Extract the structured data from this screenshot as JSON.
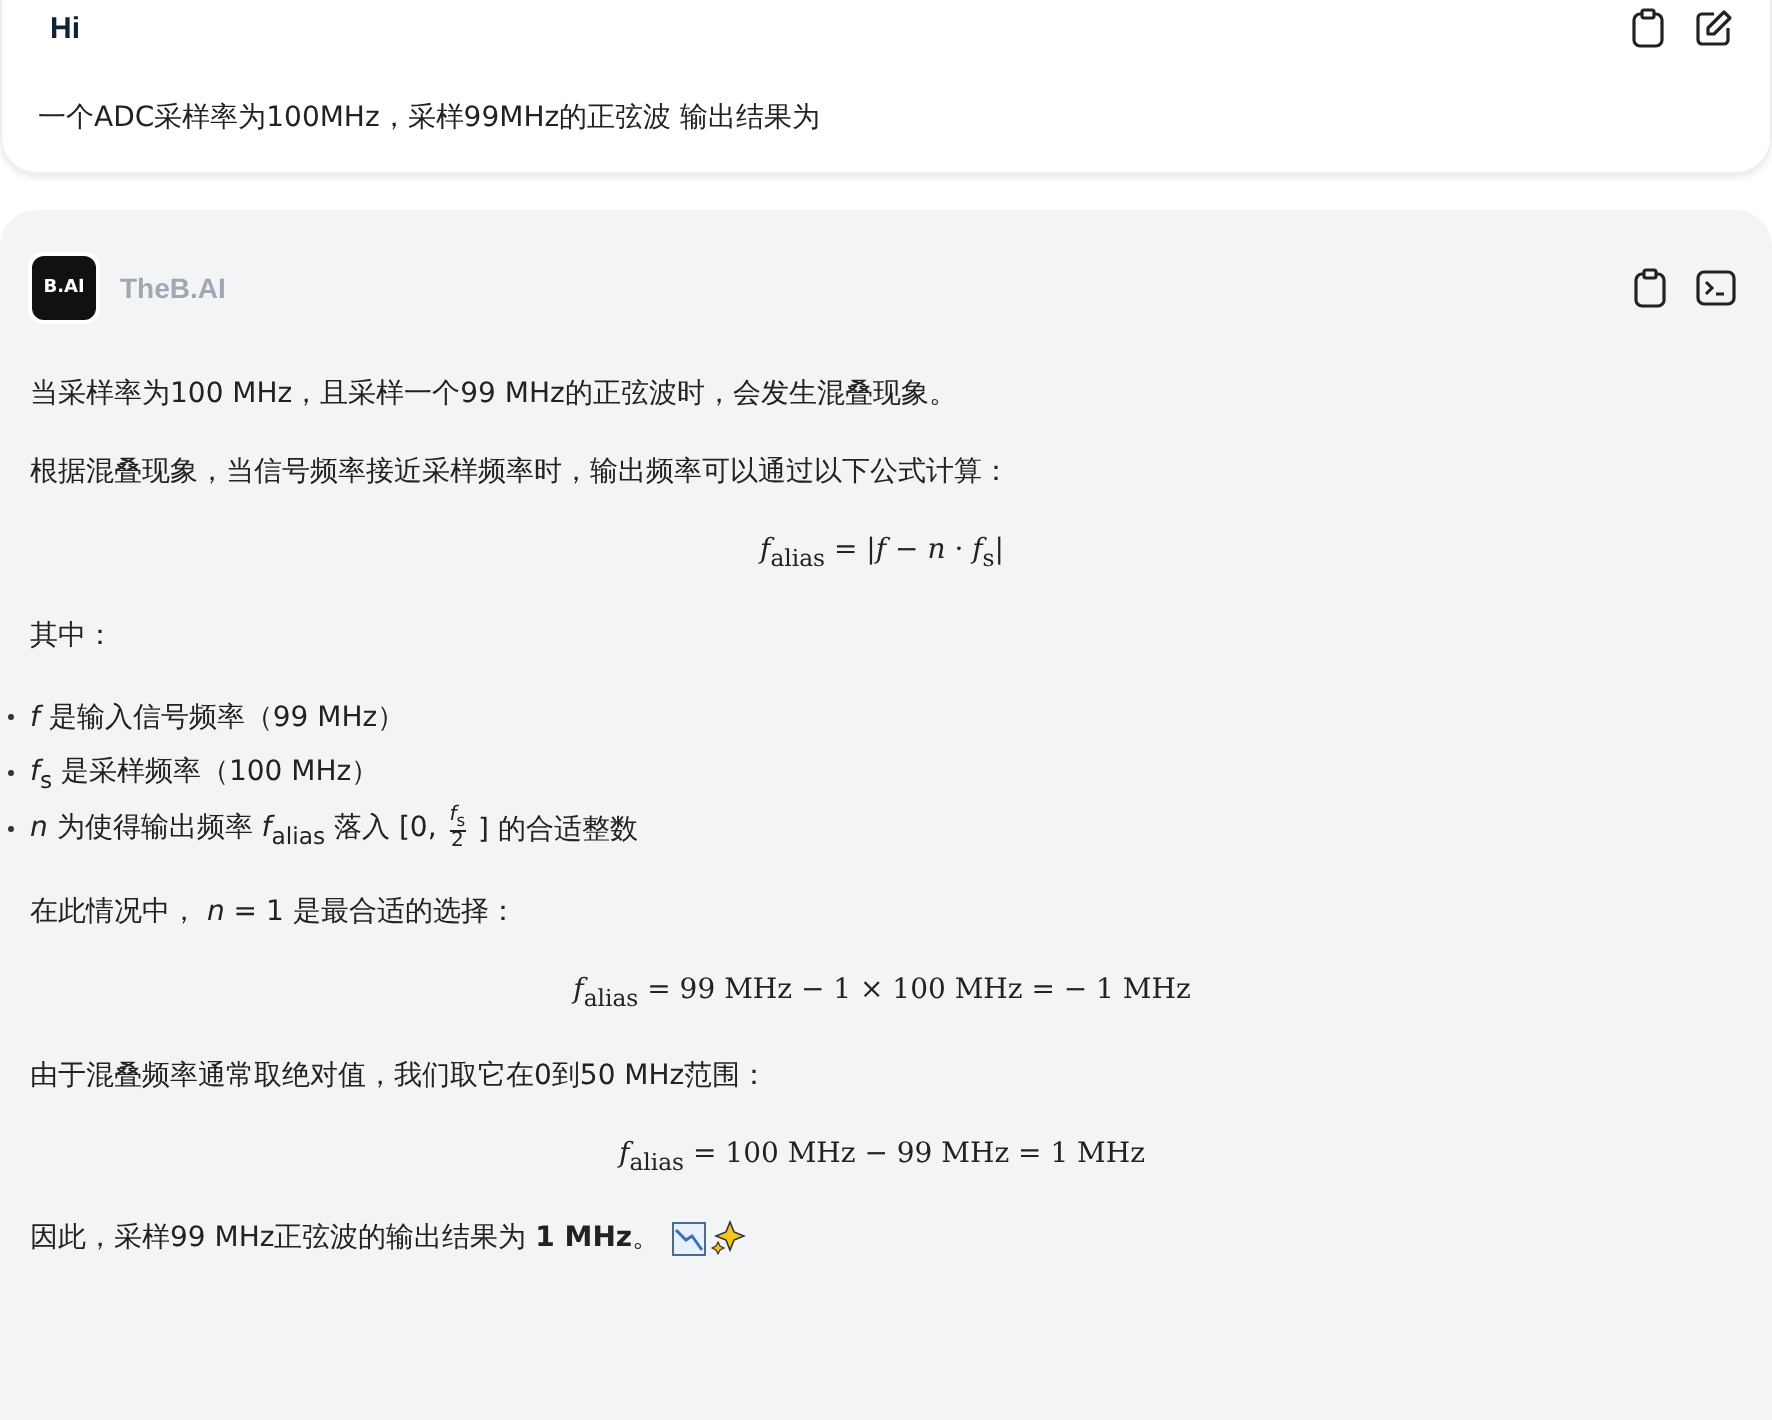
{
  "user_message": {
    "avatar": "Hi",
    "text": "一个ADC采样率为100MHz，采样99MHz的正弦波 输出结果为"
  },
  "bot_message": {
    "logo": "B.AI",
    "name": "TheB.AI",
    "blocks": [
      {
        "kind": "para",
        "text": "当采样率为100 MHz，且采样一个99 MHz的正弦波时，会发生混叠现象。"
      },
      {
        "kind": "para",
        "text": "根据混叠现象，当信号频率接近采样频率时，输出频率可以通过以下公式计算："
      },
      {
        "kind": "formula",
        "text": "*f*$_{alias}$ = |*f* − *n* · *f*$_{s}$|"
      },
      {
        "kind": "para",
        "text": "其中："
      },
      {
        "kind": "list",
        "items": [
          [
            {
              "kind": "text",
              "text": "*f* 是输入信号频率（99 MHz）"
            }
          ],
          [
            {
              "kind": "text",
              "text": "*f*$_{s}$ 是采样频率（100 MHz）"
            }
          ],
          [
            {
              "kind": "text",
              "text": "*n* 为使得输出频率 *f*$_{alias}$ 落入 [0, "
            },
            {
              "kind": "frac",
              "num": "*f*$_{s}$",
              "den": "2"
            },
            {
              "kind": "text",
              "text": " ] 的合适整数"
            }
          ]
        ]
      },
      {
        "kind": "para",
        "text": "在此情况中， *n* = 1 是最合适的选择："
      },
      {
        "kind": "formula",
        "text": "*f*$_{alias}$ = 99 MHz − 1 × 100 MHz = − 1 MHz"
      },
      {
        "kind": "para",
        "text": "由于混叠频率通常取绝对值，我们取它在0到50 MHz范围："
      },
      {
        "kind": "formula",
        "text": "*f*$_{alias}$ = 100 MHz − 99 MHz = 1 MHz"
      },
      {
        "kind": "final",
        "text": "因此，采样99 MHz正弦波的输出结果为 **1 MHz**。"
      }
    ]
  }
}
